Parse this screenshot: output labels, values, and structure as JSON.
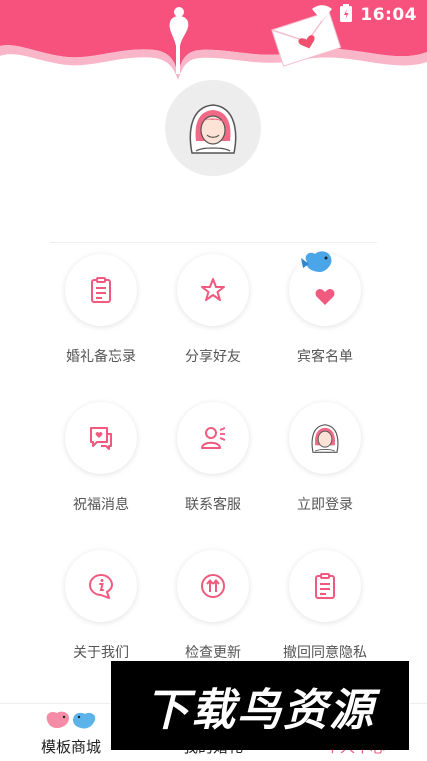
{
  "status_bar": {
    "time": "16:04"
  },
  "colors": {
    "accent": "#f05a7e",
    "header_pink": "#f7527e",
    "header_light": "#f9b6c8"
  },
  "menu": {
    "items": [
      {
        "label": "婚礼备忘录",
        "icon": "clipboard-icon"
      },
      {
        "label": "分享好友",
        "icon": "star-icon"
      },
      {
        "label": "宾客名单",
        "icon": "heart-icon"
      },
      {
        "label": "祝福消息",
        "icon": "message-heart-icon"
      },
      {
        "label": "联系客服",
        "icon": "customer-service-icon"
      },
      {
        "label": "立即登录",
        "icon": "bride-avatar-icon"
      },
      {
        "label": "关于我们",
        "icon": "info-icon"
      },
      {
        "label": "检查更新",
        "icon": "update-arrows-icon"
      },
      {
        "label": "撤回同意隐私",
        "icon": "document-icon"
      }
    ]
  },
  "tabbar": {
    "tabs": [
      {
        "label": "模板商城"
      },
      {
        "label": "我的婚礼"
      },
      {
        "label": "个人中心"
      }
    ]
  },
  "watermark": {
    "text": "下载鸟资源"
  }
}
